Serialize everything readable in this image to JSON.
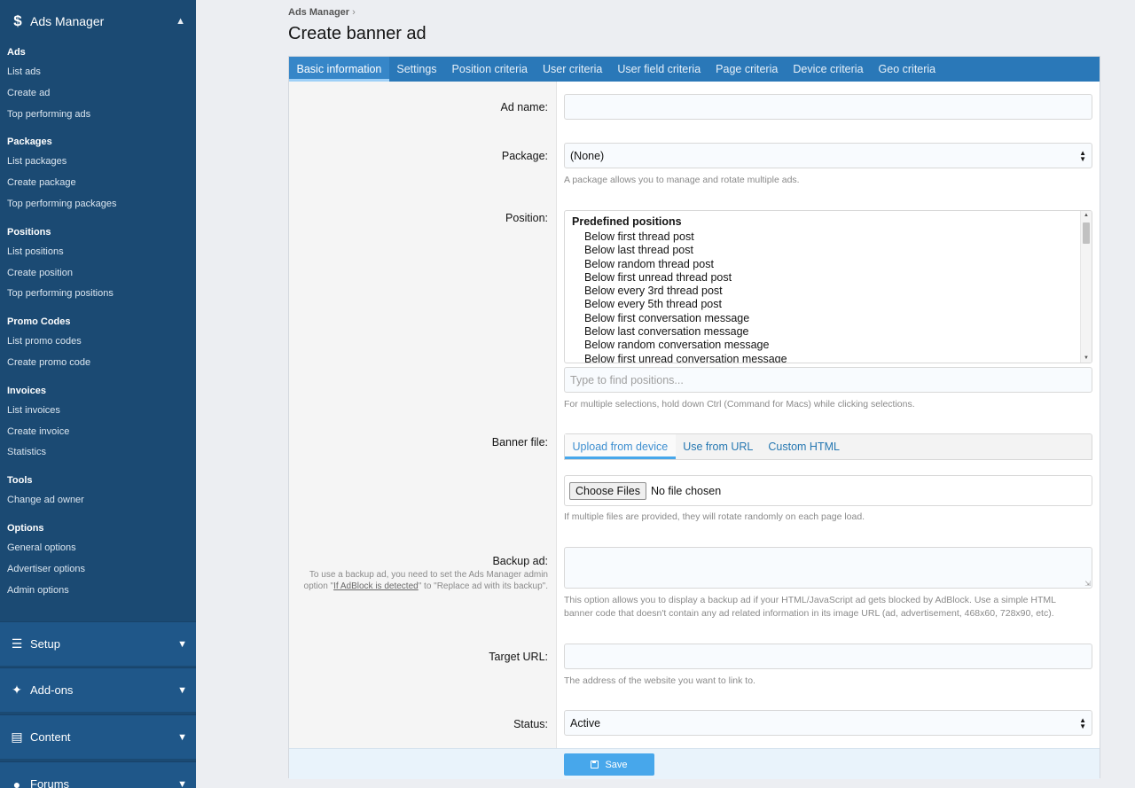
{
  "sidebar": {
    "section_title": "Ads Manager",
    "groups": [
      {
        "title": "Ads",
        "items": [
          "List ads",
          "Create ad",
          "Top performing ads"
        ]
      },
      {
        "title": "Packages",
        "items": [
          "List packages",
          "Create package",
          "Top performing packages"
        ]
      },
      {
        "title": "Positions",
        "items": [
          "List positions",
          "Create position",
          "Top performing positions"
        ]
      },
      {
        "title": "Promo Codes",
        "items": [
          "List promo codes",
          "Create promo code"
        ]
      },
      {
        "title": "Invoices",
        "items": [
          "List invoices",
          "Create invoice",
          "Statistics"
        ]
      },
      {
        "title": "Tools",
        "items": [
          "Change ad owner"
        ]
      },
      {
        "title": "Options",
        "items": [
          "General options",
          "Advertiser options",
          "Admin options"
        ]
      }
    ],
    "collapsed": [
      "Setup",
      "Add-ons",
      "Content",
      "Forums"
    ]
  },
  "breadcrumb": "Ads Manager",
  "page_title": "Create banner ad",
  "tabs": [
    "Basic information",
    "Settings",
    "Position criteria",
    "User criteria",
    "User field criteria",
    "Page criteria",
    "Device criteria",
    "Geo criteria"
  ],
  "form": {
    "ad_name_label": "Ad name:",
    "ad_name_value": "",
    "package_label": "Package:",
    "package_value": "(None)",
    "package_hint": "A package allows you to manage and rotate multiple ads.",
    "position_label": "Position:",
    "position_group": "Predefined positions",
    "positions": [
      "Below first thread post",
      "Below last thread post",
      "Below random thread post",
      "Below first unread thread post",
      "Below every 3rd thread post",
      "Below every 5th thread post",
      "Below first conversation message",
      "Below last conversation message",
      "Below random conversation message",
      "Below first unread conversation message"
    ],
    "position_search_placeholder": "Type to find positions...",
    "position_hint": "For multiple selections, hold down Ctrl (Command for Macs) while clicking selections.",
    "banner_label": "Banner file:",
    "banner_tabs": [
      "Upload from device",
      "Use from URL",
      "Custom HTML"
    ],
    "choose_files": "Choose Files",
    "no_file": "No file chosen",
    "banner_hint": "If multiple files are provided, they will rotate randomly on each page load.",
    "backup_label": "Backup ad:",
    "backup_explain_1": "To use a backup ad, you need to set the Ads Manager admin",
    "backup_explain_2a": "option \"",
    "backup_explain_link": "If AdBlock is detected",
    "backup_explain_2b": "\" to \"Replace ad with its backup\".",
    "backup_hint_1": "This option allows you to display a backup ad if your HTML/JavaScript ad gets blocked by AdBlock. Use a simple HTML",
    "backup_hint_2": "banner code that doesn't contain any ad related information in its image URL (ad, advertisement, 468x60, 728x90, etc).",
    "target_label": "Target URL:",
    "target_hint": "The address of the website you want to link to.",
    "status_label": "Status:",
    "status_value": "Active"
  },
  "save_label": "Save",
  "colors": {
    "sidebar": "#1b4a73",
    "tabbar": "#2a78b8",
    "accent": "#47a7eb"
  },
  "icons": {
    "ads_manager": "dollar-icon",
    "setup": "sliders-icon",
    "addons": "puzzle-icon",
    "content": "newspaper-icon",
    "forums": "comments-icon"
  }
}
